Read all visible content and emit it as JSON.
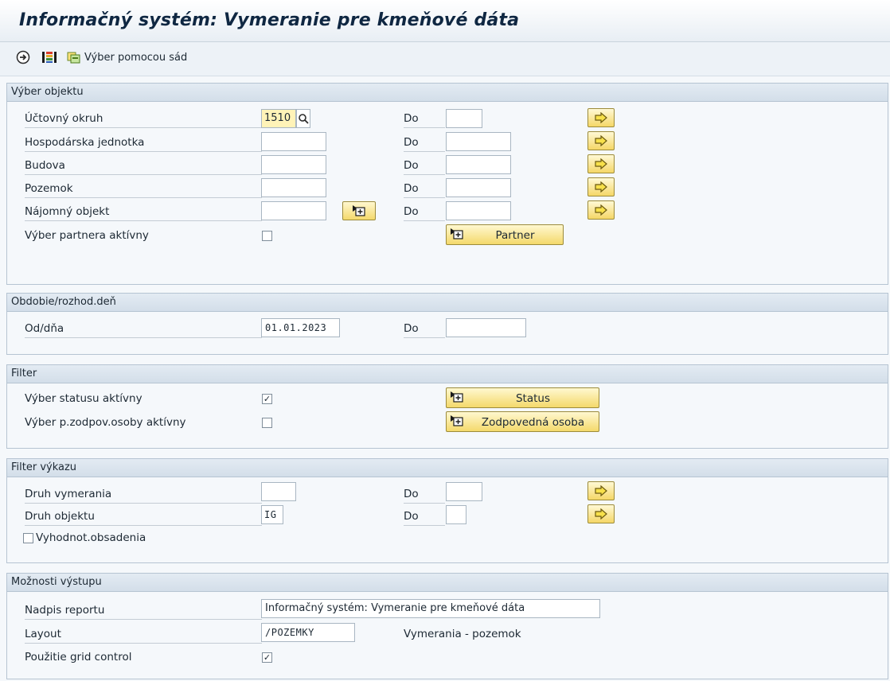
{
  "title": "Informačný systém: Vymeranie pre kmeňové dáta",
  "toolbar": {
    "execute_icon": "execute-icon",
    "layout_icon": "layout-icon",
    "selection_sets_label": "Výber pomocou sád"
  },
  "object_selection": {
    "header": "Výber objektu",
    "company_code": {
      "label": "Účtovný okruh",
      "value": "1510",
      "to_label": "Do",
      "to_value": ""
    },
    "business_entity": {
      "label": "Hospodárska jednotka",
      "value": "",
      "to_label": "Do",
      "to_value": ""
    },
    "building": {
      "label": "Budova",
      "value": "",
      "to_label": "Do",
      "to_value": ""
    },
    "property": {
      "label": "Pozemok",
      "value": "",
      "to_label": "Do",
      "to_value": ""
    },
    "rental_object": {
      "label": "Nájomný objekt",
      "value": "",
      "to_label": "Do",
      "to_value": ""
    },
    "partner_selection": {
      "label": "Výber partnera aktívny",
      "checked": false
    },
    "partner_button": "Partner"
  },
  "period": {
    "header": "Obdobie/rozhod.deň",
    "from": {
      "label": "Od/dňa",
      "value": "01.01.2023",
      "to_label": "Do",
      "to_value": ""
    }
  },
  "filter": {
    "header": "Filter",
    "status_active": {
      "label": "Výber statusu aktívny",
      "checked": true
    },
    "responsible_active": {
      "label": "Výber p.zodpov.osoby aktívny",
      "checked": false
    },
    "status_button": "Status",
    "responsible_button": "Zodpovedná osoba"
  },
  "report_filter": {
    "header": "Filter výkazu",
    "measurement_type": {
      "label": "Druh vymerania",
      "value": "",
      "to_label": "Do",
      "to_value": ""
    },
    "object_type": {
      "label": "Druh objektu",
      "value": "IG",
      "to_label": "Do",
      "to_value": ""
    },
    "occupancy": {
      "label": "Vyhodnot.obsadenia",
      "checked": false
    }
  },
  "output": {
    "header": "Možnosti výstupu",
    "report_title": {
      "label": "Nadpis reportu",
      "value": "Informačný systém: Vymeranie pre kmeňové dáta"
    },
    "layout": {
      "label": "Layout",
      "value": "/POZEMKY",
      "description": "Vymerania - pozemok"
    },
    "grid_control": {
      "label": "Použitie grid control",
      "checked": true
    }
  },
  "colors": {
    "button_yellow": "#f4d96b",
    "header_blue": "#d3dee9",
    "title": "#0f2742"
  }
}
